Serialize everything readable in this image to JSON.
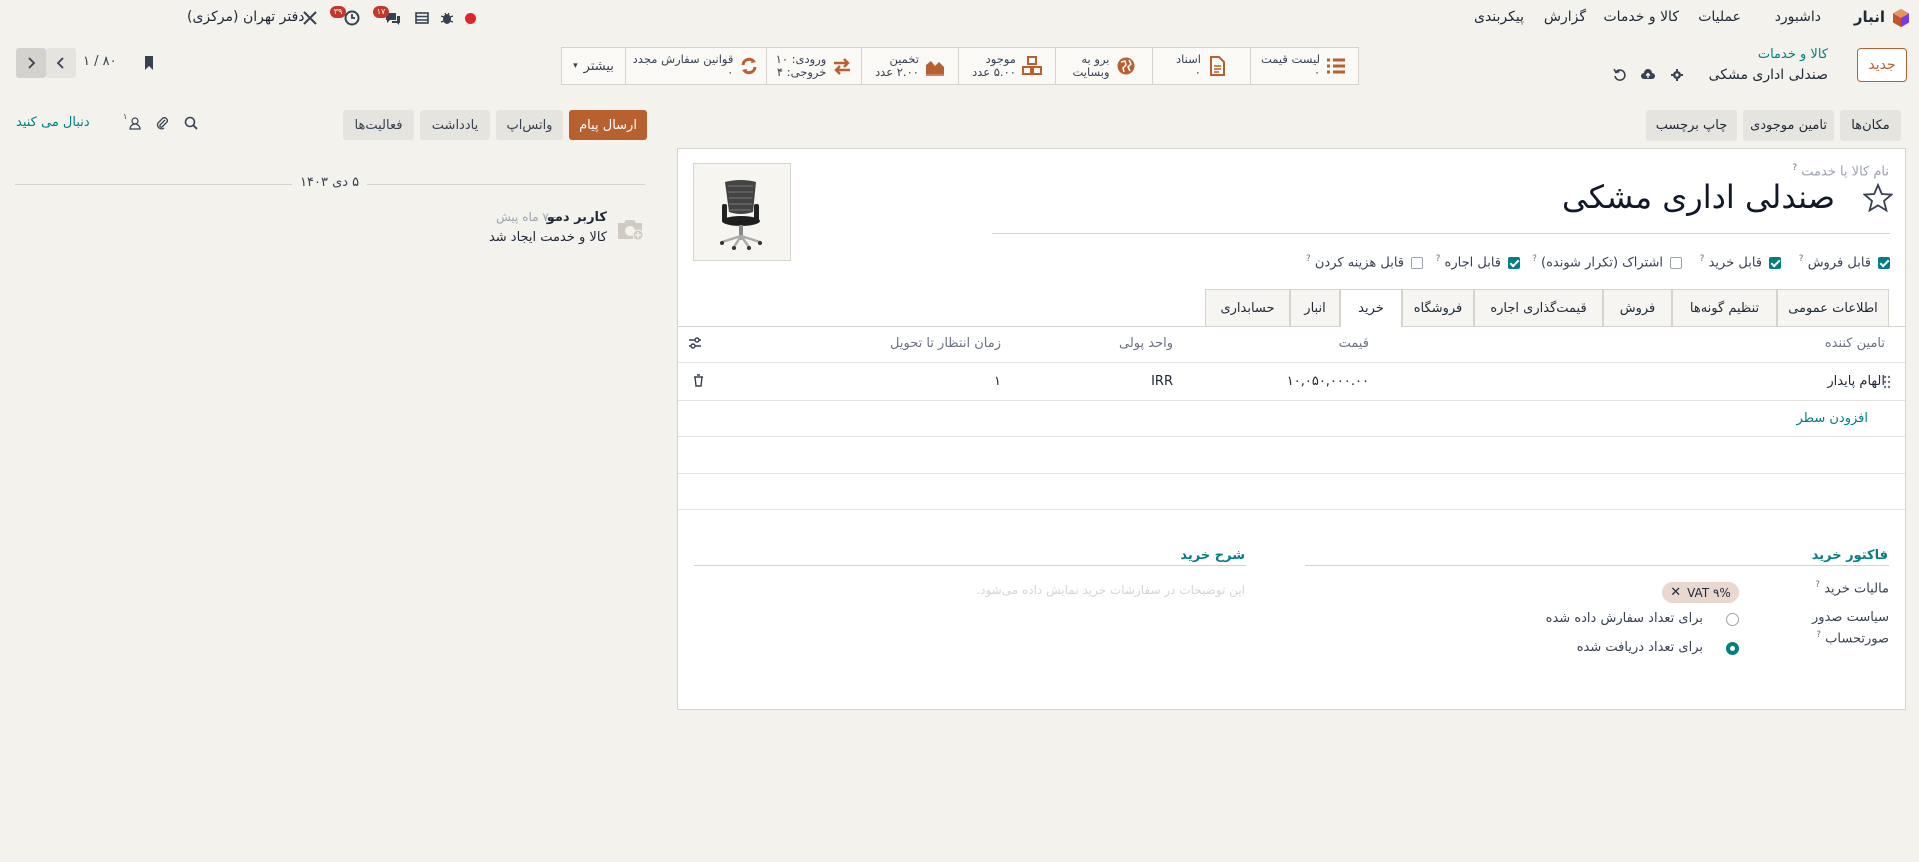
{
  "navbar": {
    "app_name": "انبار",
    "menu": [
      "داشبورد",
      "عملیات",
      "کالا و خدمات",
      "گزارش",
      "پیکربندی"
    ],
    "company": "دفتر تهران (مرکزی)",
    "activity_count": "۳۹",
    "message_count": "۱۷"
  },
  "breadcrumb": {
    "parent": "کالا و خدمات",
    "current": "صندلی اداری مشکی"
  },
  "control": {
    "new_button": "جدید",
    "pager": "۱ / ۸۰"
  },
  "smart_buttons": [
    {
      "line1": "لیست قیمت",
      "line2": "۰",
      "icon": "list-icon"
    },
    {
      "line1": "اسناد",
      "line2": "۰",
      "icon": "document-icon"
    },
    {
      "line1": "برو به",
      "line2": "وبسایت",
      "icon": "globe-icon"
    },
    {
      "line1": "موجود",
      "line2": "۵.۰۰ عدد",
      "icon": "boxes-icon"
    },
    {
      "line1": "تخمین",
      "line2": "۲.۰۰ عدد",
      "icon": "area-chart-icon"
    },
    {
      "line1": "ورودی: ۱۰",
      "line2": "خروجی: ۴",
      "icon": "arrows-exchange-icon"
    },
    {
      "line1": "قوانین سفارش مجدد",
      "line2": "۰",
      "icon": "refresh-icon"
    }
  ],
  "more_label": "بیشتر",
  "secondary_buttons": [
    "مکان‌ها",
    "تامین موجودی",
    "چاپ برچسب"
  ],
  "chatter": {
    "send_message": "ارسال پیام",
    "whatsapp": "واتس‌اپ",
    "note": "یادداشت",
    "activities": "فعالیت‌ها",
    "follow": "دنبال می کنید",
    "followers_count": "۱",
    "date": "۵ دی ۱۴۰۳",
    "author": "کاربر دمو",
    "time_ago": "- ۷ ماه پیش",
    "body": "کالا و خدمت ایجاد شد"
  },
  "form": {
    "name_label": "نام کالا یا خدمت",
    "name": "صندلی اداری مشکی",
    "checkboxes": [
      {
        "label": "قابل فروش",
        "checked": true
      },
      {
        "label": "قابل خرید",
        "checked": true
      },
      {
        "label": "اشتراک (تکرار شونده)",
        "checked": false
      },
      {
        "label": "قابل اجاره",
        "checked": true
      },
      {
        "label": "قابل هزینه کردن",
        "checked": false
      }
    ],
    "tabs": [
      "اطلاعات عمومی",
      "تنظیم گونه‌ها",
      "فروش",
      "قیمت‌گذاری اجاره",
      "فروشگاه",
      "خرید",
      "انبار",
      "حسابداری"
    ],
    "active_tab": "خرید"
  },
  "vendor_table": {
    "columns": [
      "تامین کننده",
      "قیمت",
      "واحد پولی",
      "زمان انتظار تا تحویل"
    ],
    "rows": [
      {
        "vendor": "الهام پایدار",
        "price": "۱۰,۰۵۰,۰۰۰.۰۰",
        "currency": "IRR",
        "delay": "۱"
      }
    ],
    "add_line": "افزودن سطر"
  },
  "purchase": {
    "vendor_bills_title": "فاکتور خرید",
    "description_title": "شرح خرید",
    "description_placeholder": "این توضیحات در سفارشات خرید نمایش داده می‌شود.",
    "tax_label": "مالیات خرید",
    "tax_tag": "VAT ۹%",
    "policy_label_1": "سیاست صدور",
    "policy_label_2": "صورتحساب",
    "policy_options": [
      {
        "label": "برای تعداد سفارش داده شده",
        "selected": false
      },
      {
        "label": "برای تعداد دریافت شده",
        "selected": true
      }
    ]
  },
  "colors": {
    "brand": "#b8602f",
    "teal": "#017e84",
    "background": "#f3f2ed"
  }
}
